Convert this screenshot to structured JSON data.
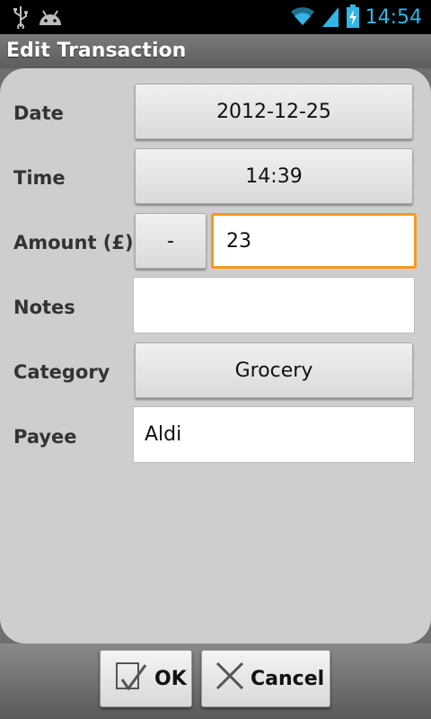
{
  "status_bar": {
    "time": "14:54",
    "icons": [
      "usb-icon",
      "android-icon",
      "wifi-icon",
      "signal-icon",
      "battery-charging-icon"
    ],
    "accent_color": "#33b5e5"
  },
  "title": "Edit Transaction",
  "form": {
    "date_label": "Date",
    "date_value": "2012-12-25",
    "time_label": "Time",
    "time_value": "14:39",
    "amount_label": "Amount (£)",
    "sign_button": "-",
    "amount_value": "23",
    "notes_label": "Notes",
    "notes_value": "",
    "category_label": "Category",
    "category_value": "Grocery",
    "payee_label": "Payee",
    "payee_value": "Aldi"
  },
  "actions": {
    "ok_label": "OK",
    "cancel_label": "Cancel"
  },
  "colors": {
    "focus_border": "#f39b1a"
  }
}
